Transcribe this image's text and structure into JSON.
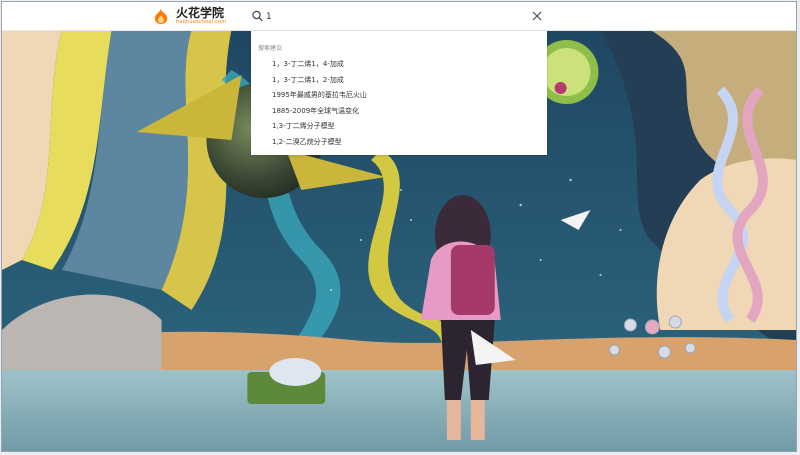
{
  "header": {
    "logo_title": "火花学院",
    "logo_subtitle": "huohuaschool.com",
    "search": {
      "value": "1"
    }
  },
  "suggestions": {
    "title": "搜索建议",
    "items": [
      "1，3-丁二烯1，4-加成",
      "1，3-丁二烯1，2-加成",
      "1995年最威男的基拉韦厄火山",
      "1885-2009年全球气温变化",
      "1,3-丁二烯分子模型",
      "1,2-二溴乙烷分子模型"
    ]
  },
  "colors": {
    "brand_orange": "#ff7a00",
    "sky_deep": "#1d3f58",
    "galaxy_yellow": "#e6d53c"
  },
  "icons": [
    "logo-flame-icon",
    "search-icon",
    "close-icon"
  ]
}
